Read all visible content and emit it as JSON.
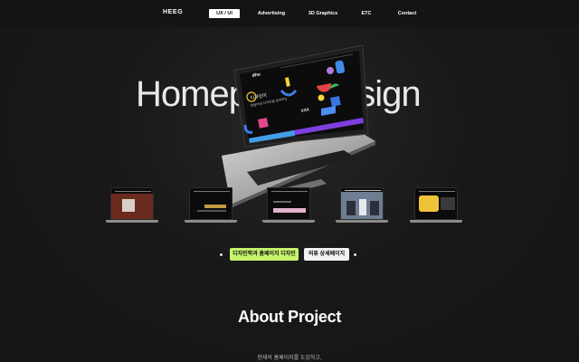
{
  "nav": {
    "logo": "HEEG",
    "items": [
      {
        "label": "UX / UI",
        "active": true
      },
      {
        "label": "Advertising",
        "active": false
      },
      {
        "label": "3D Graphics",
        "active": false
      },
      {
        "label": "ETC",
        "active": false
      },
      {
        "label": "Contact",
        "active": false
      }
    ]
  },
  "hero": {
    "title_left": "Homep",
    "title_right": "esign",
    "laptop_screen": {
      "logo": "dhu",
      "heading_line1": "디자인이",
      "heading_line2": "만들어낸 디자인을 보여주는",
      "label": "XXX"
    }
  },
  "thumbnails": [
    {
      "name": "project-1",
      "theme": "dark-red"
    },
    {
      "name": "project-2",
      "theme": "dark-gold"
    },
    {
      "name": "project-3",
      "theme": "dark-pink"
    },
    {
      "name": "project-4",
      "theme": "blue-photo"
    },
    {
      "name": "project-5",
      "theme": "yellow-dark"
    }
  ],
  "buttons": {
    "primary_label": "디자인학과 홈페이지 디자인",
    "secondary_label": "의류 상세페이지"
  },
  "about": {
    "title": "About Project",
    "text": "현재의 홈페이지를 도입하고,"
  },
  "colors": {
    "background": "#161616",
    "accent_green": "#c6f56c",
    "nav_active_bg": "#ffffff"
  }
}
